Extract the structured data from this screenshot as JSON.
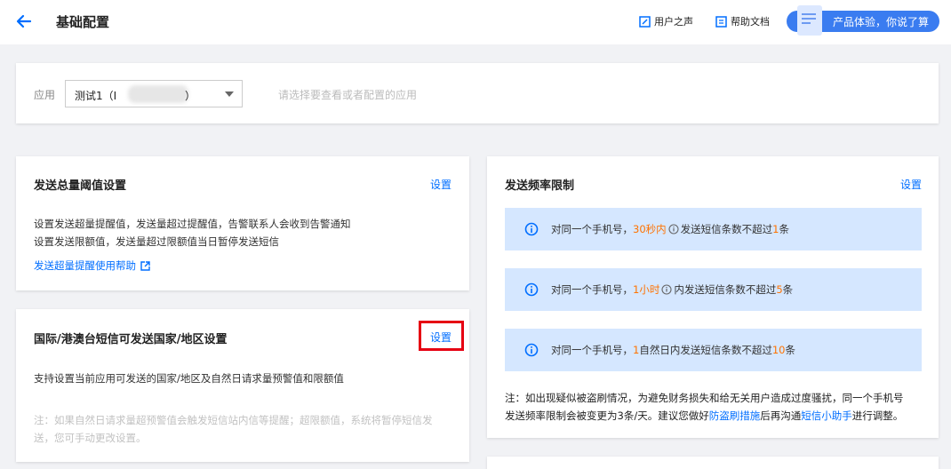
{
  "header": {
    "title": "基础配置",
    "user_voice": "用户之声",
    "help_docs": "帮助文档",
    "feedback": "产品体验，你说了算"
  },
  "app_selector": {
    "label": "应用",
    "value_prefix": "测试1（I",
    "value_suffix": "）",
    "hint": "请选择要查看或者配置的应用"
  },
  "total_threshold": {
    "title": "发送总量阈值设置",
    "action": "设置",
    "desc_line1": "设置发送超量提醒值，发送量超过提醒值，告警联系人会收到告警通知",
    "desc_line2": "设置发送限额值，发送量超过限额值当日暂停发送短信",
    "help_link": "发送超量提醒使用帮助"
  },
  "intl_settings": {
    "title": "国际/港澳台短信可发送国家/地区设置",
    "action": "设置",
    "desc": "支持设置当前应用可发送的国家/地区及自然日请求量预警值和限额值",
    "note_line1": "注：如果自然日请求量超预警值会触发短信站内信等提醒；超限额值，系统将暂停短信发",
    "note_line2": "送，您可手动更改设置。"
  },
  "rate_limit": {
    "title": "发送频率限制",
    "action": "设置",
    "rules": [
      {
        "prefix": "对同一个手机号，",
        "period": "30秒内",
        "middle": " 发送短信条数不超过",
        "count": "1",
        "suffix": "条"
      },
      {
        "prefix": "对同一个手机号，",
        "period": "1小时",
        "middle": " 内发送短信条数不超过",
        "count": "5",
        "suffix": "条"
      },
      {
        "prefix": "对同一个手机号，",
        "period": "1",
        "middle": " 自然日内发送短信条数不超过",
        "count": "10",
        "suffix": "条"
      }
    ],
    "note": {
      "line1": "注：如出现疑似被盗刷情况，为避免财务损失和给无关用户造成过度骚扰，同一个手机号",
      "line2_a": "发送频率限制会被变更为3条/天。建议您做好",
      "link1": "防盗刷措施",
      "line2_b": "后再沟通",
      "link2": "短信小助手",
      "line2_c": "进行调整。"
    }
  },
  "colors": {
    "accent": "#006eff",
    "highlight": "#ff7200",
    "info_bg": "#d5e7ff",
    "annotation_box": "#e60012"
  }
}
